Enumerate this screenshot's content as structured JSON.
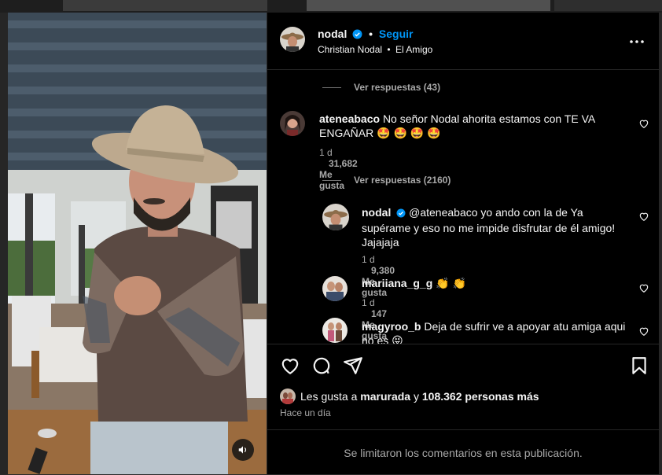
{
  "post": {
    "username": "nodal",
    "follow_label": "Seguir",
    "separator": "•",
    "artist": "Christian Nodal",
    "song": "El Amigo"
  },
  "comments": {
    "view_replies_1": "Ver respuestas (43)",
    "view_replies_2": "Ver respuestas (2160)",
    "items": [
      {
        "user": "ateneabaco",
        "text": "No señor Nodal ahorita estamos con TE VA ENGAÑAR 🤩 🤩 🤩 🤩",
        "time": "1 d",
        "likes": "31,682 Me gusta"
      },
      {
        "user": "nodal",
        "text": "@ateneabaco yo ando con la de Ya supérame y eso no me impide disfrutar de él amigo! Jajajaja",
        "time": "1 d",
        "likes": "9,380 Me gusta"
      },
      {
        "user": "mariiana_g_g",
        "text": "👏 👏",
        "time": "1 d",
        "likes": "147 Me gusta"
      },
      {
        "user": "magyroo_b",
        "text": "Deja de sufrir ve a apoyar atu amiga aqui no es 😝"
      }
    ]
  },
  "footer": {
    "likes_prefix": "Les gusta a",
    "likes_user": "marurada",
    "likes_and": "y",
    "likes_count": "108.362 personas más",
    "time_ago": "Hace un día",
    "comments_limited": "Se limitaron los comentarios en esta publicación."
  },
  "icons": [
    "heart-icon",
    "comment-icon",
    "share-icon",
    "bookmark-icon",
    "more-options-icon",
    "verified-badge-icon",
    "sound-on-icon"
  ],
  "colors": {
    "accent": "#0095f6",
    "background": "#000000",
    "muted": "#a8a8a8"
  }
}
